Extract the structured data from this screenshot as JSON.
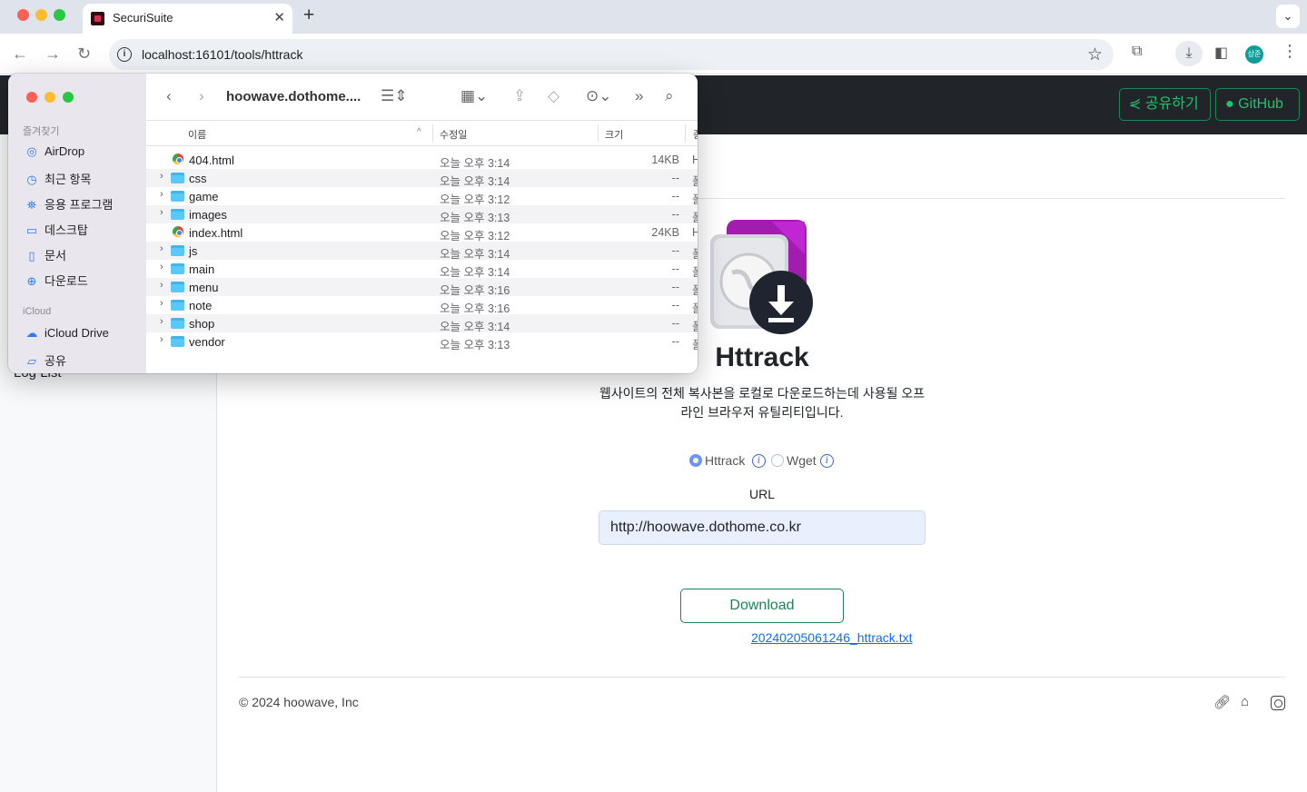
{
  "browser": {
    "tab_title": "SecuriSuite",
    "url": "localhost:16101/tools/httrack",
    "profile_initials": "상준"
  },
  "header": {
    "share_label": "공유하기",
    "github_label": "GitHub"
  },
  "sidebar": {
    "log_list_label": "Log List"
  },
  "tool": {
    "title": "Httrack",
    "description": "웹사이트의 전체 복사본을 로컬로 다운로드하는데 사용될 오프라인 브라우저 유틸리티입니다.",
    "options": [
      {
        "label": "Httrack",
        "checked": true
      },
      {
        "label": "Wget",
        "checked": false
      }
    ],
    "url_label": "URL",
    "url_value": "http://hoowave.dothome.co.kr",
    "download_label": "Download",
    "log_file_link": "20240205061246_httrack.txt"
  },
  "footer": {
    "copyright": "© 2024 hoowave, Inc"
  },
  "finder": {
    "path_title": "hoowave.dothome....",
    "favorites_label": "즐겨찾기",
    "favorites": [
      {
        "label": "AirDrop",
        "icon": "airdrop-icon"
      },
      {
        "label": "최근 항목",
        "icon": "clock-icon"
      },
      {
        "label": "응용 프로그램",
        "icon": "applications-icon"
      },
      {
        "label": "데스크탑",
        "icon": "desktop-icon"
      },
      {
        "label": "문서",
        "icon": "document-icon"
      },
      {
        "label": "다운로드",
        "icon": "download-icon"
      }
    ],
    "icloud_label": "iCloud",
    "icloud": [
      {
        "label": "iCloud Drive",
        "icon": "cloud-icon"
      },
      {
        "label": "공유",
        "icon": "shared-folder-icon"
      }
    ],
    "columns": {
      "name": "이름",
      "date": "수정일",
      "size": "크기",
      "kind": "종"
    },
    "files": [
      {
        "name": "404.html",
        "date": "오늘 오후 3:14",
        "size": "14KB",
        "kind": "H",
        "type": "html"
      },
      {
        "name": "css",
        "date": "오늘 오후 3:14",
        "size": "--",
        "kind": "폴",
        "type": "folder"
      },
      {
        "name": "game",
        "date": "오늘 오후 3:12",
        "size": "--",
        "kind": "폴",
        "type": "folder"
      },
      {
        "name": "images",
        "date": "오늘 오후 3:13",
        "size": "--",
        "kind": "폴",
        "type": "folder"
      },
      {
        "name": "index.html",
        "date": "오늘 오후 3:12",
        "size": "24KB",
        "kind": "H",
        "type": "html"
      },
      {
        "name": "js",
        "date": "오늘 오후 3:14",
        "size": "--",
        "kind": "폴",
        "type": "folder"
      },
      {
        "name": "main",
        "date": "오늘 오후 3:14",
        "size": "--",
        "kind": "폴",
        "type": "folder"
      },
      {
        "name": "menu",
        "date": "오늘 오후 3:16",
        "size": "--",
        "kind": "폴",
        "type": "folder"
      },
      {
        "name": "note",
        "date": "오늘 오후 3:16",
        "size": "--",
        "kind": "폴",
        "type": "folder"
      },
      {
        "name": "shop",
        "date": "오늘 오후 3:14",
        "size": "--",
        "kind": "폴",
        "type": "folder"
      },
      {
        "name": "vendor",
        "date": "오늘 오후 3:13",
        "size": "--",
        "kind": "폴",
        "type": "folder"
      }
    ]
  }
}
